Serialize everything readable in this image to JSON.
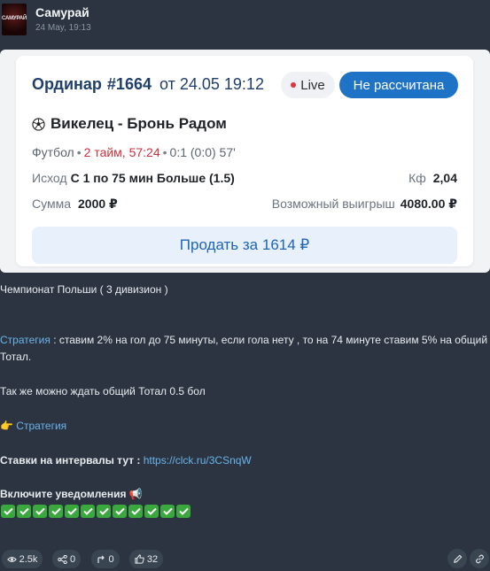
{
  "channel": {
    "name": "Самурай",
    "date": "24 May, 19:13",
    "avatar_text": "САМУРАЙ"
  },
  "bet_card": {
    "title_label": "Ординар",
    "bet_number": "#1664",
    "from_date": "от 24.05 19:12",
    "live_label": "Live",
    "status_label": "Не рассчитана",
    "match": "Викелец - Бронь Радом",
    "sport": "Футбол",
    "half_time": "2 тайм, 57:24",
    "score": "0:1 (0:0) 57'",
    "outcome_label": "Исход",
    "outcome_value": "С 1 по 75 мин Больше (1.5)",
    "kf_label": "Кф",
    "kf_value": "2,04",
    "sum_label": "Сумма",
    "sum_value": "2000 ₽",
    "win_label": "Возможный выигрыш",
    "win_value": "4080.00 ₽",
    "sell_button": "Продать за 1614 ₽"
  },
  "message": {
    "league": "Чемпионат Польши ( 3 дивизион )",
    "strategy_link": "Стратегия",
    "strategy_text": " : ставим 2% на гол до 75 минуты, если гола нету , то на 74 минуте ставим 5% на общий Тотал.",
    "alt_text": "Так же можно ждать общий Тотал 0.5 бол",
    "pointer_emoji": "👉",
    "strategy_link_2": "Стратегия",
    "intervals_label": "Ставки на интервалы тут : ",
    "intervals_link": "https://clck.ru/3CSnqW",
    "notify_text": "Включите уведомления",
    "notify_emoji": "📢",
    "check_count_text": "12"
  },
  "footer": {
    "views": "2.5k",
    "shares": "0",
    "forwards": "0",
    "likes": "32"
  },
  "colors": {
    "background": "#2b3440",
    "accent": "#1e73c7",
    "link": "#6ab4ea",
    "live_dot": "#e0333c",
    "check_green": "#3aa83d"
  }
}
